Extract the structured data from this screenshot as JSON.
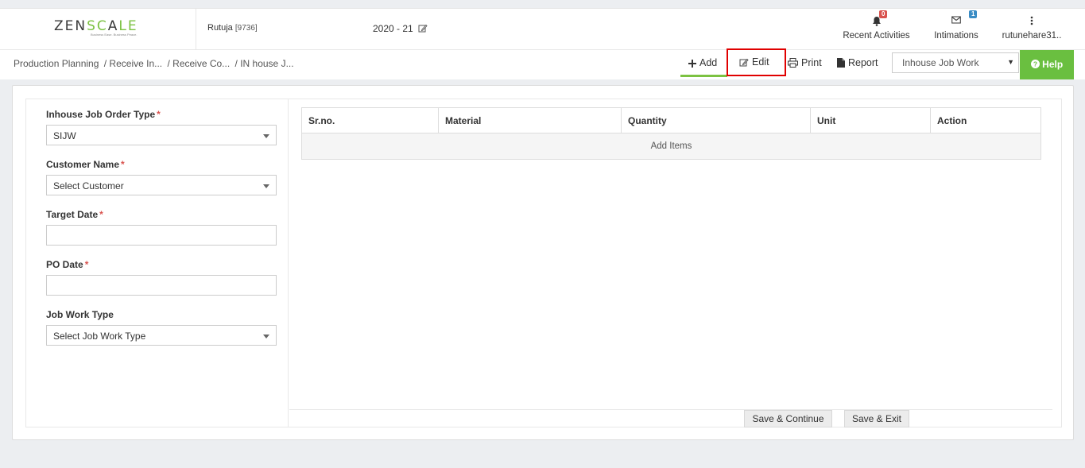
{
  "header": {
    "logo_text_main": "ZEN",
    "logo_text_accent": "SC",
    "logo_text_mid": "A",
    "logo_text_end": "LE",
    "logo_tagline": "Business Ease. Business Peace.",
    "user_name": "Rutuja",
    "user_code": "[9736]",
    "fiscal_year": "2020 - 21",
    "recent_activities_label": "Recent Activities",
    "recent_activities_count": "0",
    "intimations_label": "Intimations",
    "intimations_count": "1",
    "account_label": "rutunehare31.."
  },
  "breadcrumb": {
    "items": [
      "Production Planning",
      "/ Receive In...",
      "/ Receive Co...",
      "/ IN house J..."
    ]
  },
  "toolbar": {
    "add_label": "Add",
    "edit_label": "Edit",
    "print_label": "Print",
    "report_label": "Report",
    "job_select_value": "Inhouse Job Work",
    "help_label": "Help"
  },
  "form": {
    "order_type_label": "Inhouse Job Order Type",
    "order_type_value": "SIJW",
    "customer_label": "Customer Name",
    "customer_value": "Select Customer",
    "target_date_label": "Target Date",
    "target_date_value": "",
    "po_date_label": "PO Date",
    "po_date_value": "",
    "job_work_type_label": "Job Work Type",
    "job_work_type_value": "Select Job Work Type",
    "required_mark": "*"
  },
  "items_table": {
    "headers": [
      "Sr.no.",
      "Material",
      "Quantity",
      "Unit",
      "Action"
    ],
    "add_items_label": "Add Items"
  },
  "footer": {
    "save_continue_label": "Save & Continue",
    "save_exit_label": "Save & Exit"
  },
  "colors": {
    "accent_green": "#7cc242",
    "help_green": "#6abf40",
    "highlight_red": "#e00000",
    "badge_red": "#d9534f",
    "badge_blue": "#3a8cc4"
  }
}
